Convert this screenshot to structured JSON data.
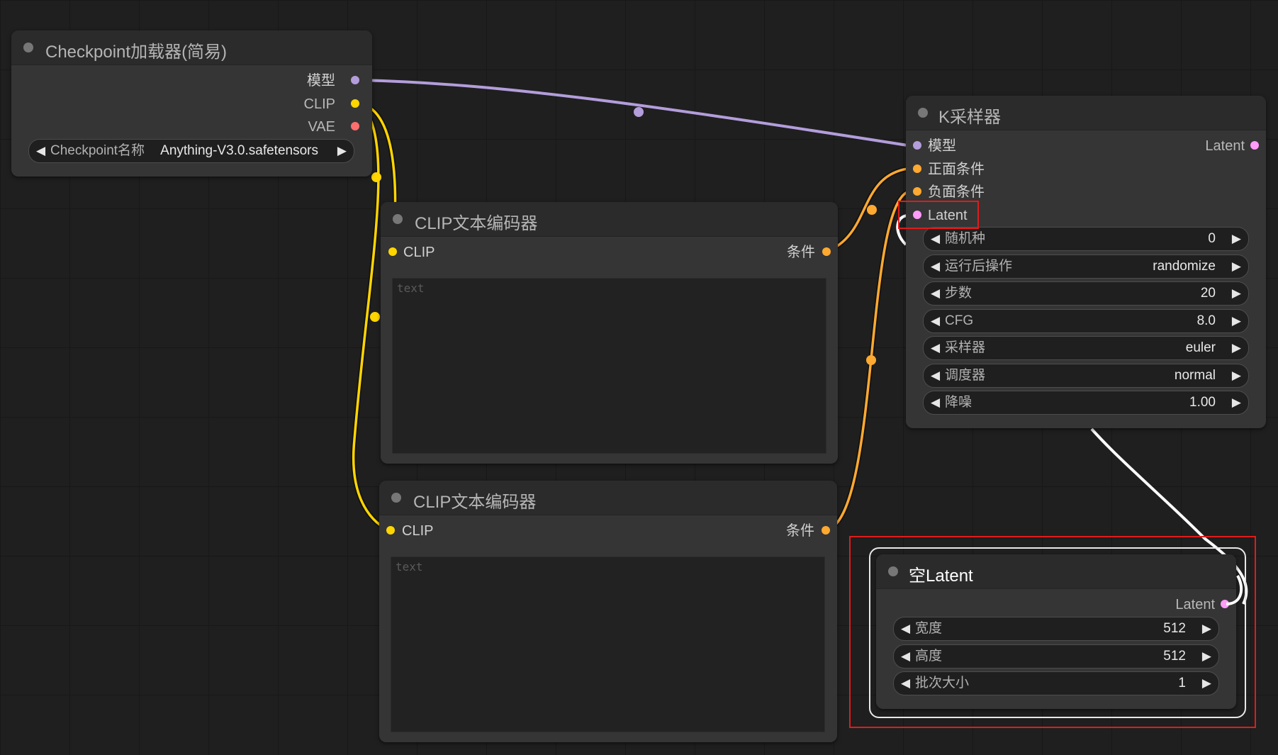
{
  "colors": {
    "model": "#b39ddb",
    "clip": "#ffd500",
    "vae": "#ff6e6e",
    "conditioning": "#ffa931",
    "latent": "#ff9cf9",
    "highlight": "#e11b1b",
    "canvas": "#1f1f1f",
    "node_bg": "#353535"
  },
  "checkpoint_loader": {
    "title": "Checkpoint加载器(简易)",
    "outputs": [
      "模型",
      "CLIP",
      "VAE"
    ],
    "widget": {
      "name": "Checkpoint名称",
      "value": "Anything-V3.0.safetensors"
    }
  },
  "clip_encoder_1": {
    "title": "CLIP文本编码器",
    "input": "CLIP",
    "output": "条件",
    "placeholder": "text"
  },
  "clip_encoder_2": {
    "title": "CLIP文本编码器",
    "input": "CLIP",
    "output": "条件",
    "placeholder": "text"
  },
  "ksampler": {
    "title": "K采样器",
    "inputs": [
      "模型",
      "正面条件",
      "负面条件",
      "Latent"
    ],
    "output": "Latent",
    "widgets": [
      {
        "name": "随机种",
        "value": "0"
      },
      {
        "name": "运行后操作",
        "value": "randomize"
      },
      {
        "name": "步数",
        "value": "20"
      },
      {
        "name": "CFG",
        "value": "8.0"
      },
      {
        "name": "采样器",
        "value": "euler"
      },
      {
        "name": "调度器",
        "value": "normal"
      },
      {
        "name": "降噪",
        "value": "1.00"
      }
    ]
  },
  "empty_latent": {
    "title": "空Latent",
    "output": "Latent",
    "widgets": [
      {
        "name": "宽度",
        "value": "512"
      },
      {
        "name": "高度",
        "value": "512"
      },
      {
        "name": "批次大小",
        "value": "1"
      }
    ]
  },
  "icons": {
    "collapse": "circle-dot",
    "decrement": "left-triangle",
    "increment": "right-triangle"
  }
}
